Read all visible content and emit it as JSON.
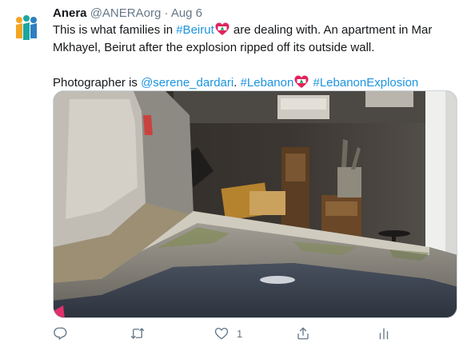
{
  "tweet": {
    "author_name": "Anera",
    "handle": "@ANERAorg",
    "separator": "·",
    "date": "Aug 6",
    "line1_a": "This is what families in ",
    "hashtag_beirut": "#Beirut",
    "line1_b": " are dealing with. An apartment in Mar Mkhayel, Beirut after the explosion ripped off its outside wall.",
    "photographer_prefix": "Photographer is ",
    "mention": "@serene_dardari",
    "period": ".",
    "hashtag_lebanon": "#Lebanon",
    "hashtag_explosion": "#LebanonExplosion",
    "like_count": "1"
  },
  "colors": {
    "link": "#1b95e0",
    "muted": "#657786",
    "logo_orange": "#f5a623",
    "logo_teal": "#1aa7a1",
    "logo_blue": "#2f7fc1",
    "flag_red": "#e0245e"
  },
  "icons": [
    "reply-icon",
    "retweet-icon",
    "like-icon",
    "share-icon",
    "analytics-icon",
    "lebanon-flag-heart-icon"
  ]
}
